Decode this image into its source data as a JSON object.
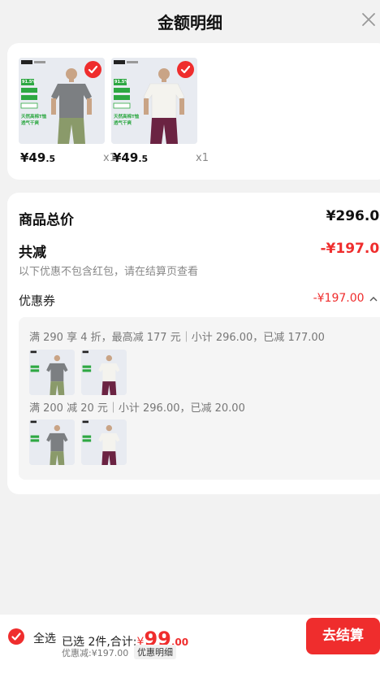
{
  "header": {
    "title": "金额明细",
    "close_icon": "close-icon"
  },
  "products": [
    {
      "price_main": "¥49",
      "price_decimal": ".5",
      "quantity": "x1",
      "selected": true,
      "shirt_color": "#7c7f82",
      "pants_color": "#8a9a6a",
      "image_text": [
        "91.5%",
        "天然高棉T恤",
        "透气干爽"
      ]
    },
    {
      "price_main": "¥49",
      "price_decimal": ".5",
      "quantity": "x1",
      "selected": true,
      "shirt_color": "#f2f1ec",
      "pants_color": "#6b2342",
      "image_text": [
        "91.5%",
        "天然高棉T恤",
        "透气干爽"
      ]
    }
  ],
  "summary": {
    "total_label": "商品总价",
    "total_value": "¥296.00",
    "reduce_label": "共减",
    "reduce_value": "-¥197.00",
    "reduce_note": "以下优惠不包含红包，请在结算页查看",
    "coupon_label": "优惠券",
    "coupon_value": "-¥197.00",
    "coupon_rules": [
      "满 290 享 4 折，最高减 177 元｜小计 296.00，已减 177.00",
      "满 200 减 20 元｜小计 296.00，已减 20.00"
    ]
  },
  "bottom": {
    "select_all": "全选",
    "selected_text": "已选 2件,合计:",
    "total_currency": "¥",
    "total_main": "99",
    "total_decimal": ".00",
    "discount_text": "优惠减:¥197.00",
    "detail_link": "优惠明细",
    "checkout_button": "去结算"
  },
  "colors": {
    "accent": "#ef2d2d",
    "background": "#f2f2f2",
    "card": "#ffffff"
  }
}
